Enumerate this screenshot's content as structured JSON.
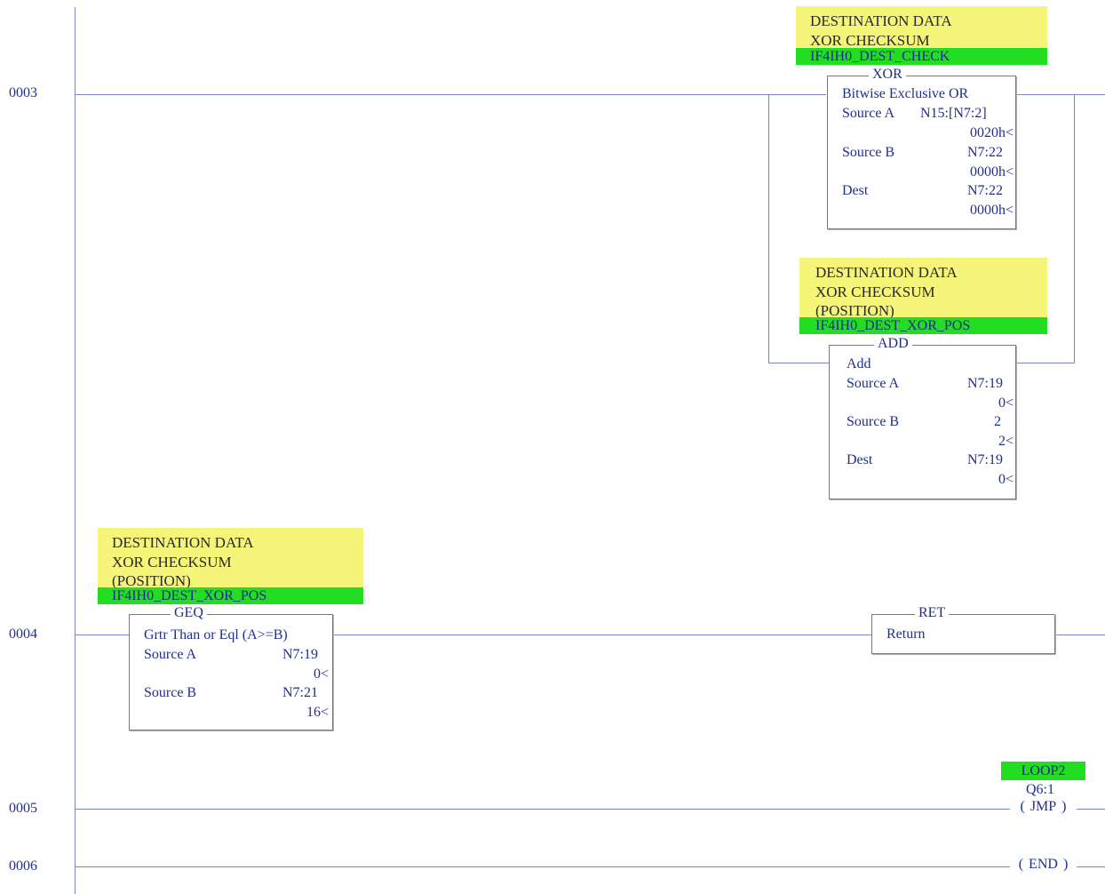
{
  "rungs": [
    {
      "number": "0003"
    },
    {
      "number": "0004"
    },
    {
      "number": "0005"
    },
    {
      "number": "0006"
    }
  ],
  "xor_note": {
    "lines": [
      "DESTINATION DATA",
      "XOR CHECKSUM"
    ],
    "tag": "IF4IH0_DEST_CHECK"
  },
  "xor_block": {
    "title": "XOR",
    "description": "Bitwise Exclusive OR",
    "source_a_label": "Source A",
    "source_a_addr": "N15:[N7:2]",
    "source_a_value": "0020h<",
    "source_b_label": "Source B",
    "source_b_addr": "N7:22",
    "source_b_value": "0000h<",
    "dest_label": "Dest",
    "dest_addr": "N7:22",
    "dest_value": "0000h<"
  },
  "add_note": {
    "lines": [
      "DESTINATION DATA",
      "XOR CHECKSUM",
      "(POSITION)"
    ],
    "tag": "IF4IH0_DEST_XOR_POS"
  },
  "add_block": {
    "title": "ADD",
    "description": "Add",
    "source_a_label": "Source A",
    "source_a_addr": "N7:19",
    "source_a_value": "0<",
    "source_b_label": "Source B",
    "source_b_addr": "2",
    "source_b_value": "2<",
    "dest_label": "Dest",
    "dest_addr": "N7:19",
    "dest_value": "0<"
  },
  "geq_note": {
    "lines": [
      "DESTINATION DATA",
      "XOR CHECKSUM",
      "(POSITION)"
    ],
    "tag": "IF4IH0_DEST_XOR_POS"
  },
  "geq_block": {
    "title": "GEQ",
    "description": "Grtr Than or Eql (A>=B)",
    "source_a_label": "Source A",
    "source_a_addr": "N7:19",
    "source_a_value": "0<",
    "source_b_label": "Source B",
    "source_b_addr": "N7:21",
    "source_b_value": "16<"
  },
  "ret_block": {
    "title": "RET",
    "description": "Return"
  },
  "jmp": {
    "tag": "LOOP2",
    "address": "Q6:1",
    "label": "JMP"
  },
  "end": {
    "label": "END"
  },
  "colors": {
    "note_yellow": "#f5f57a",
    "tag_green": "#22dd22",
    "wire": "#7a86c4",
    "text_blue": "#1f2f8f"
  }
}
